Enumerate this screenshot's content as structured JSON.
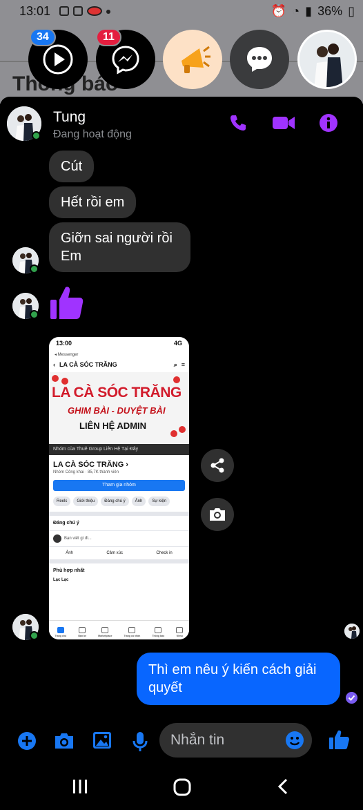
{
  "status_bar": {
    "time": "13:01",
    "battery": "36%"
  },
  "background": {
    "title": "Thông báo"
  },
  "chat_heads": [
    {
      "name": "play-app",
      "badge": "34"
    },
    {
      "name": "messenger-app",
      "badge": "11"
    },
    {
      "name": "megaphone"
    },
    {
      "name": "messages"
    },
    {
      "name": "tung-avatar"
    }
  ],
  "conversation": {
    "name": "Tung",
    "status": "Đang hoạt động",
    "messages_in": [
      "Cút",
      "Hết rồi em",
      "Giỡn sai người rồi Em"
    ],
    "message_out": "Thì em nêu ý kiến cách giải quyết"
  },
  "shared_image": {
    "time": "13:00",
    "signal": "4G",
    "sub": "◂ Messenger",
    "group_header": "LA CÀ SÓC TRĂNG",
    "cover_line1": "LA CÀ SÓC TRĂNG",
    "cover_line2": "GHIM BÀI - DUYỆT BÀI",
    "cover_line3": "LIÊN HỆ ADMIN",
    "band": "Nhóm của Thuê Group Liên Hệ Tại Đây",
    "group_name": "LA CÀ SÓC TRĂNG ›",
    "group_meta": "Nhóm Công khai · 85,7K thành viên",
    "join": "Tham gia nhóm",
    "chips": [
      "Reels",
      "Giới thiệu",
      "Đáng chú ý",
      "Ảnh",
      "Sự kiện"
    ],
    "featured": "Đáng chú ý",
    "post_placeholder": "Bạn viết gì đi...",
    "actions": [
      "Ảnh",
      "Cảm xúc",
      "Check in"
    ],
    "best_match": "Phù hợp nhất",
    "poster": "Lạc Lạc",
    "tabs": [
      "Trang chủ",
      "Bạn bè",
      "Marketplace",
      "Trang cá nhân",
      "Thông báo",
      "Menu"
    ]
  },
  "composer": {
    "placeholder": "Nhắn tin"
  },
  "colors": {
    "accent": "#a033ff",
    "outgoing": "#0866ff",
    "incoming": "#303030",
    "composer_icons": "#1877f2"
  }
}
